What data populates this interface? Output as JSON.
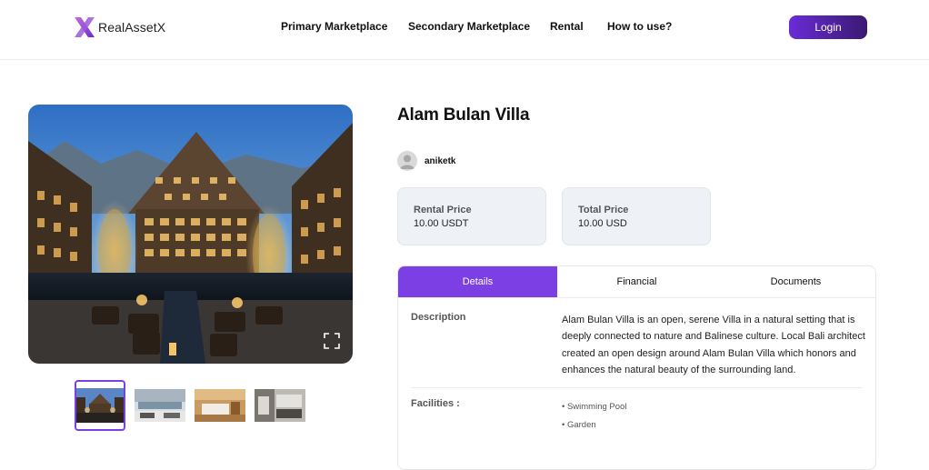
{
  "header": {
    "brand": "RealAssetX",
    "nav": [
      "Primary Marketplace",
      "Secondary Marketplace",
      "Rental",
      "How to use?"
    ],
    "login_label": "Login"
  },
  "property": {
    "title": "Alam Bulan Villa",
    "owner": "aniketk",
    "rental_price_label": "Rental Price",
    "rental_price_value": "10.00 USDT",
    "total_price_label": "Total Price",
    "total_price_value": "10.00 USD"
  },
  "tabs": [
    "Details",
    "Financial",
    "Documents"
  ],
  "details": {
    "description_label": "Description",
    "description_text": "Alam Bulan Villa is an open, serene Villa in a natural setting that is deeply connected to nature and Balinese culture. Local Bali architect created an open design around Alam Bulan Villa which honors and enhances the natural beauty of the surrounding land.",
    "facilities_label": "Facilities :",
    "facilities": [
      "• Swimming Pool",
      "• Garden"
    ]
  },
  "colors": {
    "accent": "#7b3fe4",
    "login_gradient_start": "#6a2bd6",
    "login_gradient_end": "#3a1a72",
    "card_bg": "#eef1f6"
  },
  "icons": {
    "logo": "x-logo-icon",
    "fullscreen": "fullscreen-icon",
    "avatar": "user-avatar-icon"
  }
}
